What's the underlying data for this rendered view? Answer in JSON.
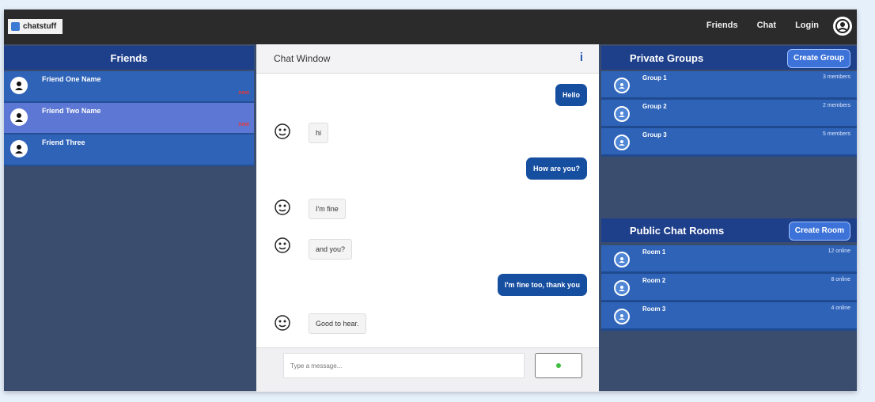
{
  "app": {
    "logo_text": "chatstuff"
  },
  "nav": {
    "items": [
      "Friends",
      "Chat",
      "Login"
    ]
  },
  "friends": {
    "title": "Friends",
    "items": [
      {
        "name": "Friend One Name",
        "badge": "new"
      },
      {
        "name": "Friend Two Name",
        "badge": "new"
      },
      {
        "name": "Friend Three",
        "badge": ""
      }
    ]
  },
  "chat": {
    "title": "Chat Window",
    "info_icon": "i",
    "messages": [
      {
        "dir": "out",
        "text": "Hello"
      },
      {
        "dir": "in",
        "text": "hi"
      },
      {
        "dir": "out",
        "text": "How are you?"
      },
      {
        "dir": "in",
        "text": "I'm fine"
      },
      {
        "dir": "in",
        "text": "and you?"
      },
      {
        "dir": "out",
        "text": "I'm fine too, thank you"
      },
      {
        "dir": "in",
        "text": "Good to hear."
      }
    ],
    "input_placeholder": "Type a message...",
    "send_icon": "send-icon"
  },
  "private_groups": {
    "title": "Private Groups",
    "button": "Create Group",
    "items": [
      {
        "name": "Group 1",
        "meta": "3 members"
      },
      {
        "name": "Group 2",
        "meta": "2 members"
      },
      {
        "name": "Group 3",
        "meta": "5 members"
      }
    ]
  },
  "public_rooms": {
    "title": "Public Chat Rooms",
    "button": "Create Room",
    "items": [
      {
        "name": "Room 1",
        "meta": "12 online"
      },
      {
        "name": "Room 2",
        "meta": "8 online"
      },
      {
        "name": "Room 3",
        "meta": "4 online"
      }
    ]
  },
  "colors": {
    "accent": "#164ea0",
    "list_item": "#2e63b8",
    "active_item": "#5c77d4",
    "badge": "#e23b3b"
  }
}
